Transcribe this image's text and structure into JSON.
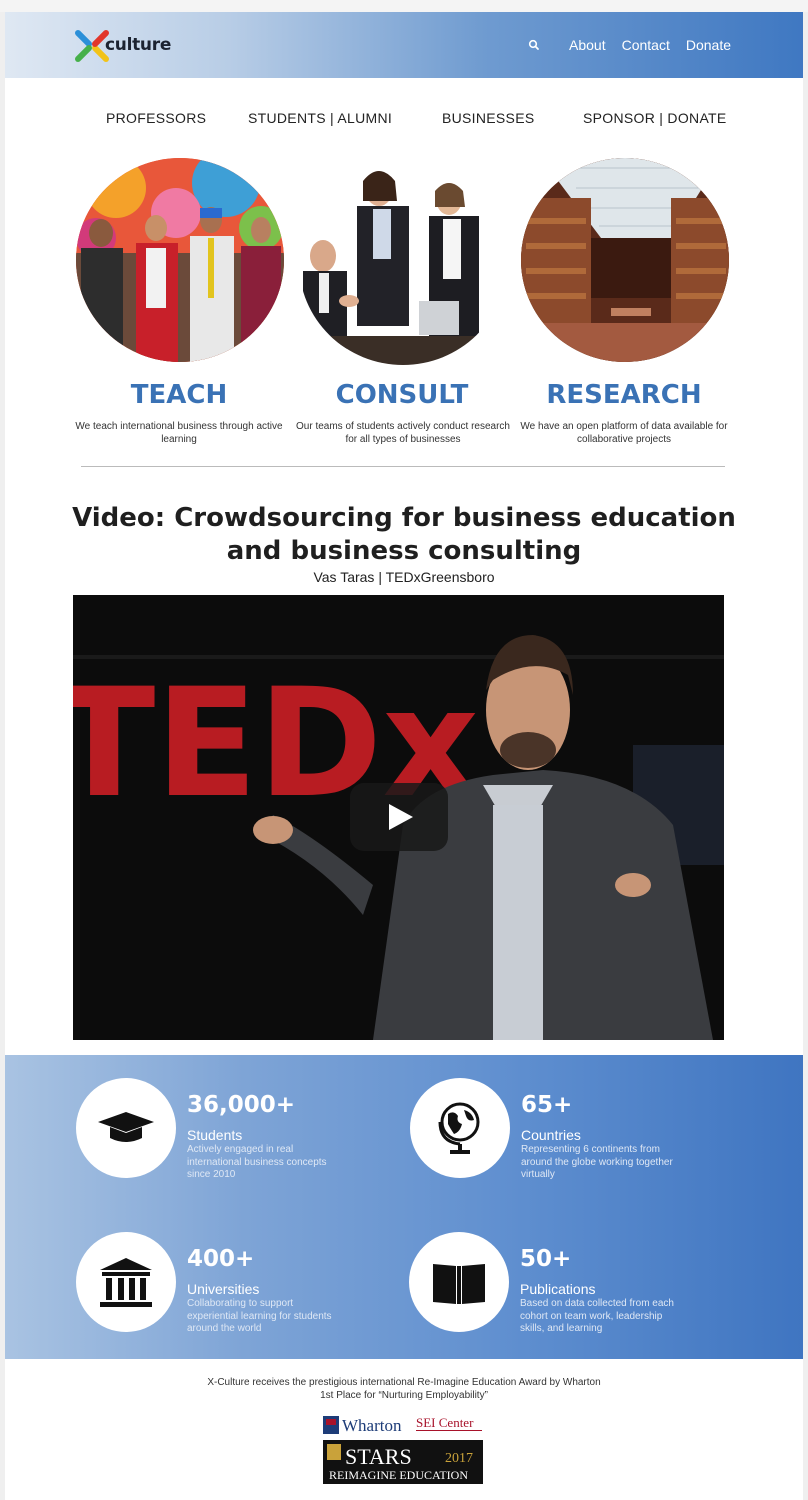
{
  "header": {
    "logo_text": "culture",
    "nav": [
      "About",
      "Contact",
      "Donate"
    ]
  },
  "menu": [
    "PROFESSORS",
    "STUDENTS | ALUMNI",
    "BUSINESSES",
    "SPONSOR | DONATE"
  ],
  "pillars": [
    {
      "title": "TEACH",
      "desc": "We teach international business through active learning"
    },
    {
      "title": "CONSULT",
      "desc": "Our teams of students actively conduct research for all types of businesses"
    },
    {
      "title": "RESEARCH",
      "desc": "We have an open platform of data available for collaborative projects"
    }
  ],
  "video": {
    "title": "Video:  Crowdsourcing for business education and business consulting",
    "subtitle": "Vas Taras | TEDxGreensboro",
    "backdrop_text": "TEDx"
  },
  "stats": [
    {
      "number": "36,000+",
      "label": "Students",
      "desc": "Actively engaged in real international business concepts since 2010",
      "icon": "graduation-cap-icon"
    },
    {
      "number": "65+",
      "label": "Countries",
      "desc": "Representing 6 continents from around the globe working together virtually",
      "icon": "globe-icon"
    },
    {
      "number": "400+",
      "label": "Universities",
      "desc": "Collaborating to support experiential learning for students around the world",
      "icon": "university-icon"
    },
    {
      "number": "50+",
      "label": "Publications",
      "desc": "Based on data collected from each cohort on team work, leadership skills, and learning",
      "icon": "book-icon"
    }
  ],
  "award": {
    "line1": "X-Culture receives the prestigious international Re-Imagine Education Award by Wharton",
    "line2": "1st Place for “Nurturing Employability”",
    "wharton_text": "Wharton",
    "sei_text": "SEI Center",
    "stars_text": "STARS",
    "stars_year": "2017",
    "reimagine_text": "REIMAGINE EDUCATION"
  },
  "colors": {
    "accent": "#3a72b5",
    "header_end": "#3f78c2",
    "stats_start": "#a9c3e2",
    "stats_end": "#3f75c1"
  }
}
